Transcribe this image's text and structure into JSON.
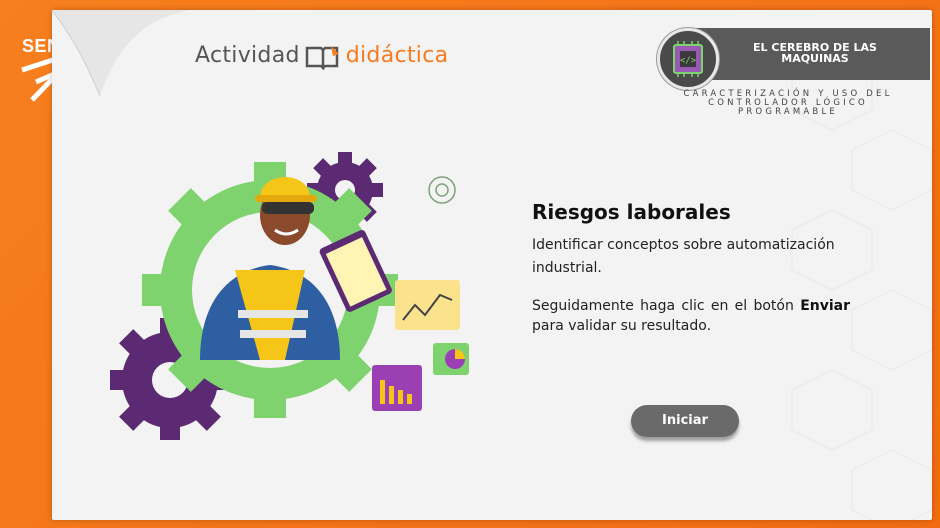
{
  "brand": {
    "name": "SENA"
  },
  "header": {
    "activity_word": "Actividad",
    "activity_word2": "didáctica",
    "course_title": "EL CEREBRO DE LAS MAQUINAS",
    "course_subtitle": "CARACTERIZACIÓN Y USO DEL CONTROLADOR LÓGICO PROGRAMABLE"
  },
  "main": {
    "heading": "Riesgos laborales",
    "description": "Identificar conceptos  sobre automatización industrial.",
    "instruction_pre": "Seguidamente haga clic en el botón ",
    "instruction_bold": "Enviar",
    "instruction_post": " para validar su resultado.",
    "start_button": "Iniciar"
  },
  "colors": {
    "orange": "#f47b20",
    "green": "#7ed36f",
    "purple": "#5b2a72",
    "button": "#6a6a6a"
  }
}
